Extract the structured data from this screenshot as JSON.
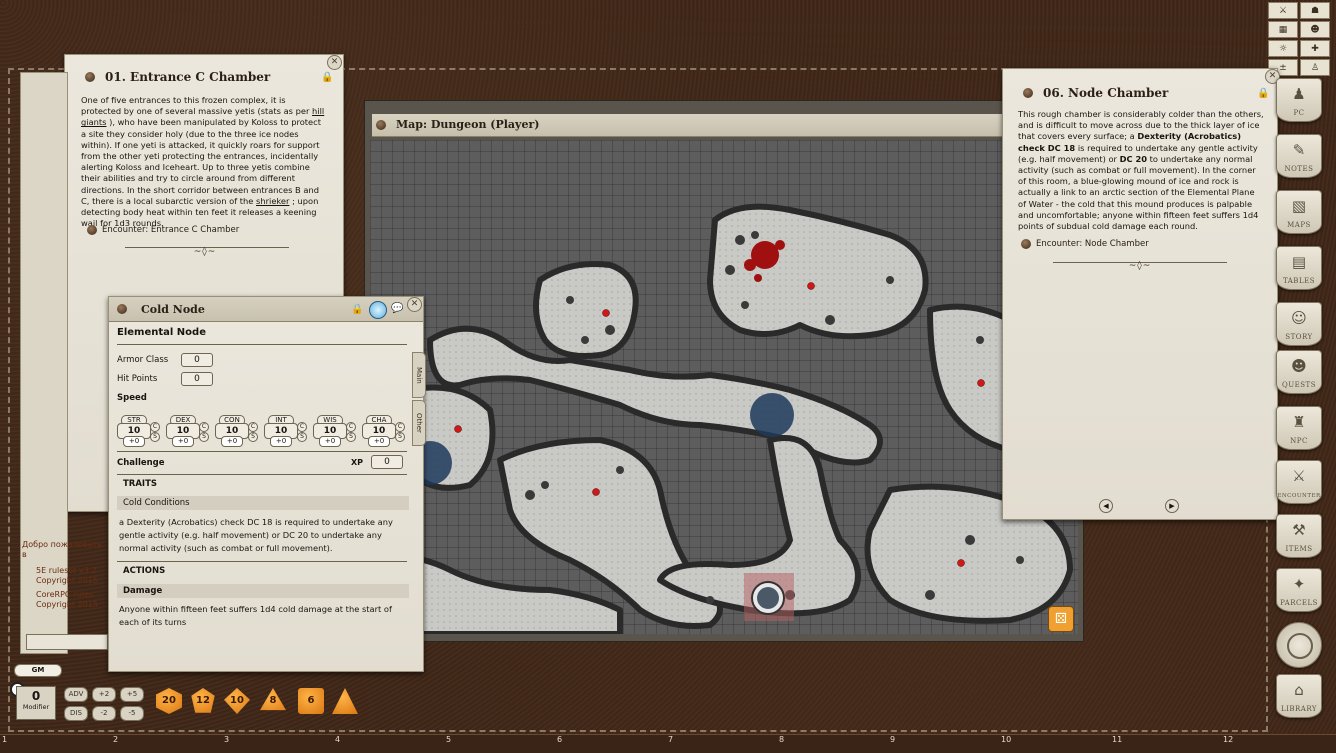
{
  "entrance_window": {
    "title": "01. Entrance C Chamber",
    "text_segments": [
      "One of five entrances to this frozen complex, it is protected by one of several massive yetis (stats as per ",
      "hill giants",
      " ), who have been manipulated by Koloss to protect a site they consider holy (due to the three ice nodes within). If one yeti is attacked, it quickly roars for support from the other yeti protecting the entrances, incidentally alerting Koloss and Iceheart. Up to three yetis combine their abilities and try to circle around from different directions. In the short corridor between entrances B and C, there is a local subarctic version of the ",
      "shrieker",
      " ; upon detecting body heat within ten feet it releases a keening wail for 1d3 rounds."
    ],
    "encounter_link": "Encounter: Entrance C Chamber"
  },
  "map_window": {
    "title": "Map: Dungeon (Player)"
  },
  "node_window": {
    "title": "06. Node Chamber",
    "text_segments": [
      "This rough chamber is considerably colder than the others, and is difficult to move across due to the thick layer of ice that covers every surface; a ",
      "Dexterity (Acrobatics) check DC 18",
      " is required to undertake any gentle activity (e.g. half movement) or ",
      "DC 20",
      " to undertake any normal activity (such as combat or full movement). In the corner of this room, a blue-glowing mound of ice and rock is actually a link to an arctic section of the Elemental Plane of Water - the cold that this mound produces is palpable and uncomfortable; anyone within fifteen feet suffers 1d4 points of subdual cold damage each round."
    ],
    "encounter_link": "Encounter: Node Chamber"
  },
  "cold_node": {
    "title": "Cold Node",
    "type": "Elemental Node",
    "armor_class_label": "Armor Class",
    "armor_class": "0",
    "hit_points_label": "Hit Points",
    "hit_points": "0",
    "speed_label": "Speed",
    "stats": [
      {
        "name": "STR",
        "value": "10",
        "mod": "+0"
      },
      {
        "name": "DEX",
        "value": "10",
        "mod": "+0"
      },
      {
        "name": "CON",
        "value": "10",
        "mod": "+0"
      },
      {
        "name": "INT",
        "value": "10",
        "mod": "+0"
      },
      {
        "name": "WIS",
        "value": "10",
        "mod": "+0"
      },
      {
        "name": "CHA",
        "value": "10",
        "mod": "+0"
      }
    ],
    "challenge_label": "Challenge",
    "xp_label": "XP",
    "xp": "0",
    "traits_header": "TRAITS",
    "trait_name": "Cold Conditions",
    "trait_text": "a Dexterity (Acrobatics) check DC 18 is required to undertake any gentle activity (e.g. half movement) or DC 20 to undertake any normal activity (such as combat or full movement).",
    "actions_header": "ACTIONS",
    "action_name": "Damage",
    "action_text": "Anyone within fifteen feet suffers 1d4 cold damage at the start of each of its turns",
    "tabs": [
      "Main",
      "Other"
    ]
  },
  "chat": {
    "welcome": "Добро пожаловать в",
    "ruleset1": "5E ruleset v3.2",
    "copyright1": "Copyright 2015",
    "ruleset2": "CoreRPG rules",
    "copyright2": "Copyright 2015"
  },
  "gm_label": "GM",
  "modifier": {
    "value": "0",
    "label": "Modifier"
  },
  "mod_buttons": [
    "ADV",
    "+2",
    "+5",
    "DIS",
    "-2",
    "-5"
  ],
  "dice": [
    "20",
    "12",
    "10",
    "8",
    "6",
    "4"
  ],
  "sidebar": [
    {
      "label": "PC",
      "icon": "person-icon"
    },
    {
      "label": "NOTES",
      "icon": "quill-icon"
    },
    {
      "label": "MAPS",
      "icon": "map-icon"
    },
    {
      "label": "TABLES",
      "icon": "table-icon"
    },
    {
      "label": "STORY",
      "icon": "masks-icon"
    },
    {
      "label": "QUESTS",
      "icon": "quest-icon"
    },
    {
      "label": "NPC",
      "icon": "horned-helm-icon"
    },
    {
      "label": "ENCOUNTER",
      "icon": "swords-icon"
    },
    {
      "label": "ITEMS",
      "icon": "item-icon"
    },
    {
      "label": "PARCELS",
      "icon": "parcel-icon"
    },
    {
      "label": "",
      "icon": "token-icon"
    },
    {
      "label": "LIBRARY",
      "icon": "library-icon"
    }
  ],
  "ruler_ticks": [
    "1",
    "2",
    "3",
    "4",
    "5",
    "6",
    "7",
    "8",
    "9",
    "10",
    "11",
    "12"
  ]
}
